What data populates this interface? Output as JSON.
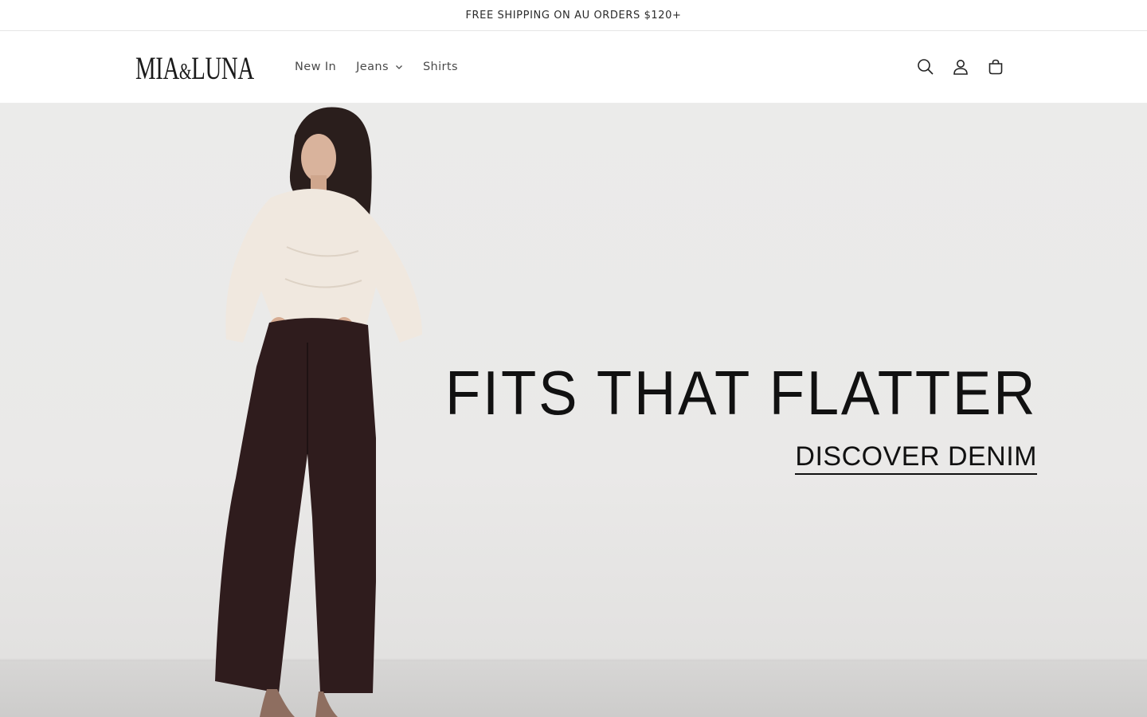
{
  "announcement": {
    "text": "FREE SHIPPING ON AU ORDERS $120+"
  },
  "header": {
    "logo": {
      "part1": "MIA",
      "amp": "&",
      "part2": "LUNA"
    },
    "nav": [
      {
        "label": "New In",
        "has_dropdown": false
      },
      {
        "label": "Jeans",
        "has_dropdown": true
      },
      {
        "label": "Shirts",
        "has_dropdown": false
      }
    ],
    "icons": [
      "search-icon",
      "account-icon",
      "cart-icon"
    ]
  },
  "hero": {
    "headline": "FITS THAT FLATTER",
    "cta_label": "DISCOVER DENIM"
  },
  "colors": {
    "text": "#121212",
    "nav_text": "#4a4a4a",
    "hero_bg": "#ebebea"
  }
}
